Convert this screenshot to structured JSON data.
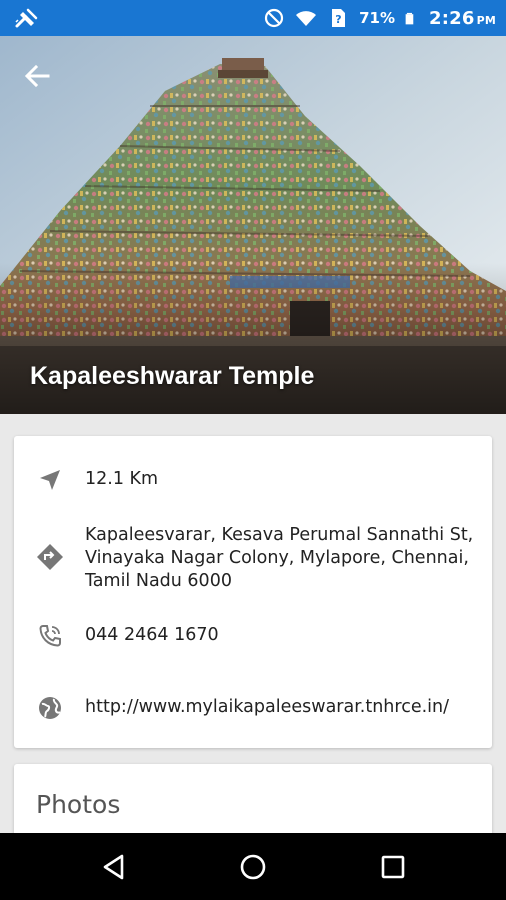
{
  "status_bar": {
    "battery_percent": "71%",
    "time": "2:26",
    "ampm": "PM",
    "background": "#1976d2"
  },
  "place": {
    "name": "Kapaleeshwarar Temple",
    "distance": "12.1 Km",
    "address": "Kapaleesvarar, Kesava Perumal Sannathi St, Vinayaka Nagar Colony, Mylapore, Chennai, Tamil Nadu 6000",
    "phone": "044 2464 1670",
    "website": "http://www.mylaikapaleeswarar.tnhrce.in/"
  },
  "photos": {
    "title": "Photos"
  },
  "icons": {
    "back": "arrow-back-icon",
    "distance": "navigation-arrow-icon",
    "address": "directions-icon",
    "phone": "phone-icon",
    "website": "globe-icon"
  }
}
